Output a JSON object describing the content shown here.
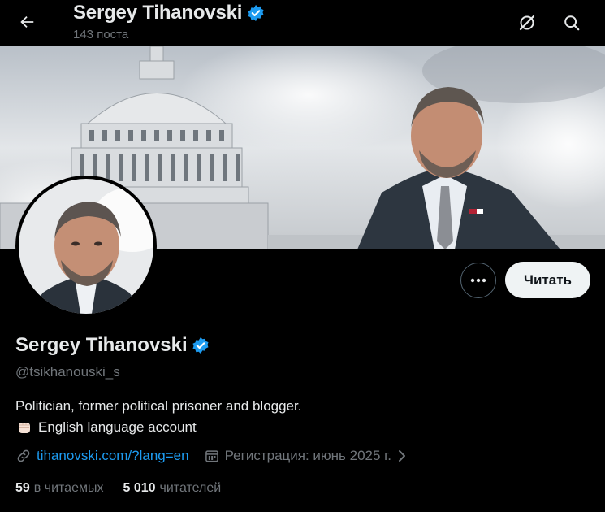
{
  "header": {
    "title": "Sergey Tihanovski",
    "post_count": "143 поста"
  },
  "profile": {
    "display_name": "Sergey Tihanovski",
    "handle": "@tsikhanouski_s",
    "bio_line1": "Politician, former political prisoner and blogger.",
    "bio_line2": "English language account",
    "website": "tihanovski.com/?lang=en",
    "joined": "Регистрация: июнь 2025 г.",
    "following_count": "59",
    "following_label": "в читаемых",
    "followers_count": "5 010",
    "followers_label": "читателей"
  },
  "actions": {
    "follow_label": "Читать"
  },
  "icons": {
    "back": "arrow-left-icon",
    "grok": "grok-icon",
    "search": "search-icon",
    "verified": "verified-badge-icon",
    "more": "more-dots-icon",
    "link": "link-icon",
    "calendar": "calendar-icon",
    "chevron": "chevron-right-icon",
    "fist": "raised-fist-emoji"
  },
  "colors": {
    "background": "#000000",
    "accent": "#1d9bf0",
    "text_primary": "#e7e9ea",
    "text_secondary": "#71767b",
    "button_bg": "#eff3f4"
  }
}
